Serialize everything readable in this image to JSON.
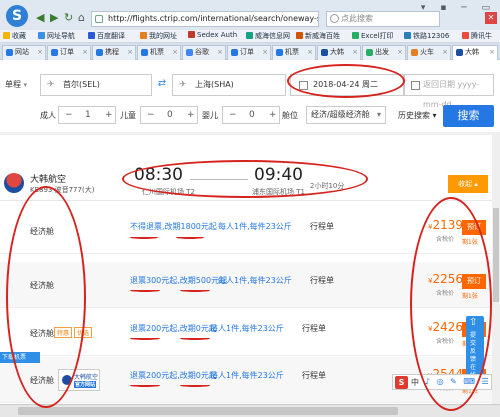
{
  "browser": {
    "url": "http://flights.ctrip.com/international/search/oneway-sel",
    "search_placeholder": "点此搜索"
  },
  "bookmarks": [
    "收藏",
    "网址导航",
    "百度翻译",
    "我的网址",
    "Sedex Auth",
    "威海信息网",
    "新威海百姓",
    "Excel打印",
    "铁路12306",
    "腾讯牛"
  ],
  "tabs": [
    "网站",
    "订单",
    "携程",
    "机票",
    "谷歌",
    "订单",
    "机票",
    "大韩",
    "出发",
    "火车",
    "大韩"
  ],
  "search_form": {
    "trip_type": "单程",
    "from": "首尔(SEL)",
    "to": "上海(SHA)",
    "depart_date": "2018-04-24",
    "depart_weekday": "周二",
    "return_placeholder": "返回日期 yyyy-mm-dd",
    "adult_label": "成人",
    "adult_count": "1",
    "child_label": "儿童",
    "child_count": "0",
    "infant_label": "婴儿",
    "infant_count": "0",
    "cabin_label": "舱位",
    "cabin_value": "经济/超级经济舱",
    "history_label": "历史搜索",
    "search_button": "搜索"
  },
  "flight": {
    "airline": "大韩航空",
    "flight_no": "KE893 波音777(大)",
    "depart_time": "08:30",
    "depart_airport": "仁川国际机场 T2",
    "arrive_time": "09:40",
    "arrive_airport": "浦东国际机场 T1",
    "duration": "2小时10分",
    "collapse_label": "收起"
  },
  "fares": [
    {
      "cabin": "经济舱",
      "rule": "不得退票,改期1800元起",
      "baggage": "每人1件,每件23公斤",
      "itinerary": "行程单",
      "price": "2139",
      "tax": "含税价",
      "book": "预订",
      "left": "剩1张"
    },
    {
      "cabin": "经济舱",
      "rule": "退票300元起,改期500元起",
      "baggage": "每人1件,每件23公斤",
      "itinerary": "行程单",
      "price": "2256",
      "tax": "含税价",
      "book": "预订",
      "left": "剩1张"
    },
    {
      "cabin": "经济舱",
      "tags": [
        "特惠",
        "优选"
      ],
      "rule": "退票200元起,改期0元起",
      "baggage": "每人1件,每件23公斤",
      "itinerary": "行程单",
      "price": "2426",
      "tax": "含税价",
      "book": "预订",
      "left": "剩1张"
    },
    {
      "cabin": "经济舱",
      "brand": "大韩航空",
      "brand_tag": "官方网站",
      "rule": "退票200元起,改期0元起",
      "baggage": "每人1件,每件23公斤",
      "itinerary": "行程单",
      "price": "2544",
      "tax": "含税价",
      "book": "预订",
      "left": "剩1张"
    }
  ],
  "widget": {
    "top_label": "提交反馈",
    "bottom_label": "在线客服"
  },
  "download_badge": "下载机票",
  "ime": {
    "label": "中"
  },
  "currency": "¥"
}
